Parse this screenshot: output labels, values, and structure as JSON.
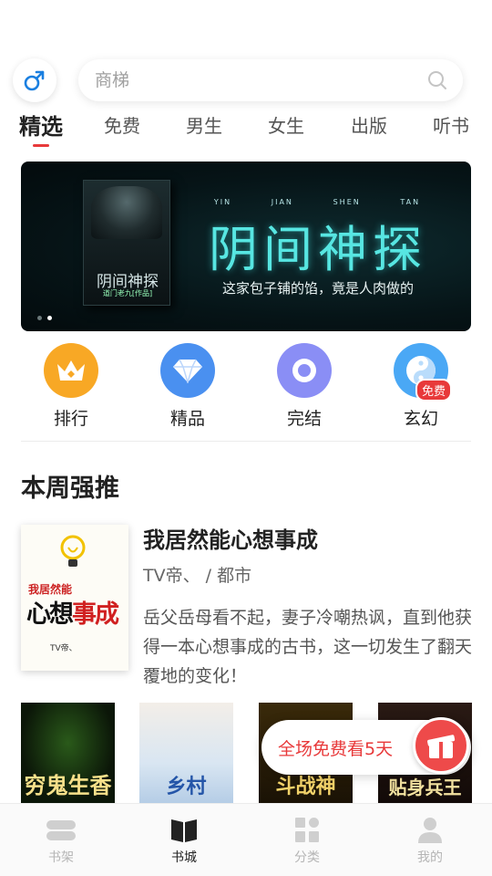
{
  "search": {
    "placeholder": "商梯"
  },
  "tabs": [
    {
      "label": "精选"
    },
    {
      "label": "免费"
    },
    {
      "label": "男生"
    },
    {
      "label": "女生"
    },
    {
      "label": "出版"
    },
    {
      "label": "听书"
    }
  ],
  "banner": {
    "pinyin": [
      "YIN",
      "JIAN",
      "SHEN",
      "TAN"
    ],
    "title": "阴间神探",
    "tagline": "这家包子铺的馅，竟是人肉做的",
    "cover_title": "阴间神探",
    "cover_subtitle": "道门老九[作品]"
  },
  "categories": [
    {
      "label": "排行",
      "icon": "crown-icon",
      "color": "#f8a825"
    },
    {
      "label": "精品",
      "icon": "diamond-icon",
      "color": "#4a90f0"
    },
    {
      "label": "完结",
      "icon": "ring-icon",
      "color": "#8a8ef5"
    },
    {
      "label": "玄幻",
      "icon": "yin-yang-icon",
      "color": "#4aa8f5",
      "badge": "免费"
    }
  ],
  "section": {
    "title": "本周强推"
  },
  "featured": {
    "title": "我居然能心想事成",
    "meta": "TV帝、 / 都市",
    "description": "岳父岳母看不起，妻子冷嘲热讽，直到他获得一本心想事成的古书，这一切发生了翻天覆地的变化！",
    "cover_line1": "我居然能",
    "cover_line2a": "心想",
    "cover_line2b": "事成",
    "cover_author": "TV帝、"
  },
  "row_books": [
    {
      "cover_text": "穷鬼生香"
    },
    {
      "cover_text": "乡村"
    },
    {
      "cover_text": "斗战神"
    },
    {
      "cover_text": "贴身兵王"
    }
  ],
  "promo": {
    "text": "全场免费看5天"
  },
  "bottom_nav": [
    {
      "label": "书架"
    },
    {
      "label": "书城"
    },
    {
      "label": "分类"
    },
    {
      "label": "我的"
    }
  ],
  "colors": {
    "accent": "#e8393a",
    "banner_title": "#57e6e2"
  }
}
